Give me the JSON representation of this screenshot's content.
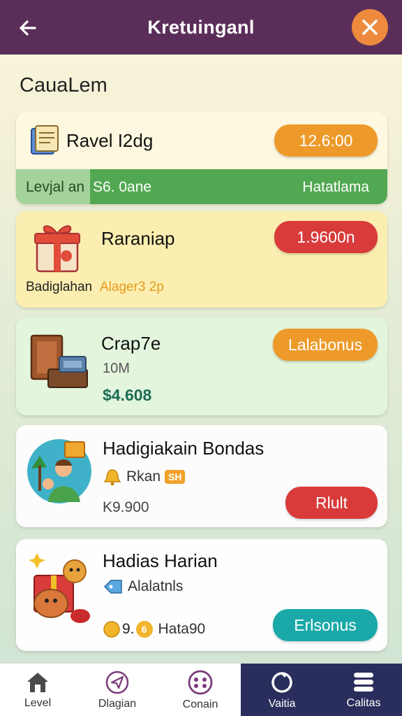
{
  "header": {
    "title": "Kretuinganl"
  },
  "section": {
    "heading": "CauaLem"
  },
  "cards": [
    {
      "name": "Ravel I2dg",
      "price": "12.6:00",
      "strip": {
        "left": "Levjal an",
        "middle": "S6. 0ane",
        "right": "Hatatlama"
      },
      "icon": "notebook-icon"
    },
    {
      "name": "Raraniap",
      "price": "1.9600n",
      "subtitle_dark": "Badiglahan",
      "subtitle_accent": "Alager3 2p",
      "icon": "gift-box-icon"
    },
    {
      "name": "Crap7e",
      "button": "Lalabonus",
      "meta": "10M",
      "amount": "$4.608",
      "icon": "treasure-chest-icon"
    },
    {
      "name": "Hadigiakain Bondas",
      "detail": "Rkan",
      "tag": "SH",
      "amount": "K9.900",
      "button": "Rlult",
      "icon": "family-avatar-icon"
    },
    {
      "name": "Hadias Harian",
      "detail": "Alalatnls",
      "coins": "9.",
      "coin_value": "6",
      "amount": "Hata90",
      "button": "Erlsonus",
      "icon": "monster-gift-icon"
    }
  ],
  "nav": [
    {
      "label": "Level",
      "icon": "home-icon"
    },
    {
      "label": "Dlagian",
      "icon": "send-icon"
    },
    {
      "label": "Conain",
      "icon": "dots-circle-icon"
    },
    {
      "label": "Vaitia",
      "icon": "ring-icon"
    },
    {
      "label": "Calitas",
      "icon": "stack-icon"
    }
  ],
  "colors": {
    "header": "#5b2e5a",
    "orange": "#ee9a2a",
    "red": "#d93a3a",
    "teal": "#1aa8a8",
    "green": "#52a852",
    "nav_dark": "#2a2e5c"
  }
}
